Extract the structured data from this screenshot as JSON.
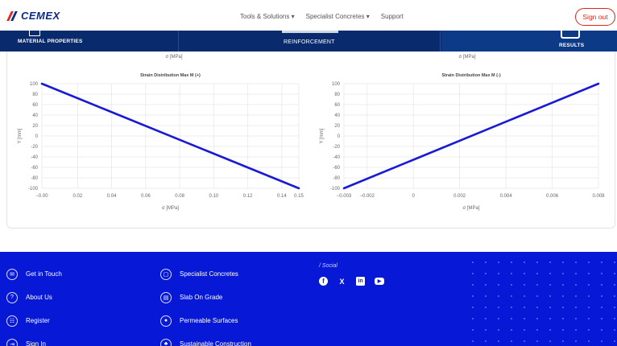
{
  "header": {
    "logo_text": "CEMEX",
    "nav": [
      "Tools & Solutions ▾",
      "Specialist Concretes ▾",
      "Support"
    ],
    "signout_label": "Sign out"
  },
  "tabs": {
    "material": "MATERIAL PROPERTIES",
    "reinforcement": "REINFORCEMENT",
    "results": "RESULTS"
  },
  "panel": {
    "top_left_label": "σ [MPa]",
    "top_right_label": "σ [MPa]"
  },
  "colors": {
    "brand_blue": "#0b2a8a",
    "brand_red": "#e2231a",
    "series_line": "#1a1ad6",
    "footer_bg": "#0718d6"
  },
  "chart_data": [
    {
      "type": "line",
      "title": "Strain Distribution Max M (+)",
      "xlabel": "σ [MPa]",
      "ylabel": "Y [mm]",
      "xlim": [
        -0.001,
        0.15
      ],
      "ylim": [
        -100,
        100
      ],
      "xticks": [
        -0.001,
        0.02,
        0.04,
        0.06,
        0.08,
        0.1,
        0.12,
        0.14,
        0.15
      ],
      "xtick_labels": [
        "−0.00",
        "0.02",
        "0.04",
        "0.06",
        "0.08",
        "0.10",
        "0.12",
        "0.14",
        "0.15"
      ],
      "yticks": [
        100,
        80,
        60,
        40,
        20,
        0,
        -20,
        -40,
        -60,
        -80,
        -100
      ],
      "grid": true,
      "series": [
        {
          "x": [
            -0.001,
            0.15
          ],
          "y": [
            100,
            -100
          ]
        }
      ]
    },
    {
      "type": "line",
      "title": "Strain Distribution Max M (-)",
      "xlabel": "σ [MPa]",
      "ylabel": "Y [mm]",
      "xlim": [
        -0.003,
        0.008
      ],
      "ylim": [
        -100,
        100
      ],
      "xticks": [
        -0.003,
        -0.002,
        0,
        0.002,
        0.004,
        0.006,
        0.008
      ],
      "xtick_labels": [
        "−0.003",
        "−0.002",
        "0",
        "0.002",
        "0.004",
        "0.006",
        "0.008"
      ],
      "yticks": [
        100,
        80,
        60,
        40,
        20,
        0,
        -20,
        -40,
        -60,
        -80,
        -100
      ],
      "grid": true,
      "series": [
        {
          "x": [
            -0.003,
            0.008
          ],
          "y": [
            -100,
            100
          ]
        }
      ]
    }
  ],
  "footer": {
    "col1": [
      {
        "label": "Get in Touch",
        "icon": "email-icon",
        "glyph": "✉"
      },
      {
        "label": "About Us",
        "icon": "help-icon",
        "glyph": "?"
      },
      {
        "label": "Register",
        "icon": "register-icon",
        "glyph": "☷"
      },
      {
        "label": "Sign In",
        "icon": "sign-in-icon",
        "glyph": "⇥"
      }
    ],
    "col2": [
      {
        "label": "Specialist Concretes",
        "icon": "concrete-icon",
        "glyph": "▢"
      },
      {
        "label": "Slab On Grade",
        "icon": "slab-icon",
        "glyph": "▤"
      },
      {
        "label": "Permeable Surfaces",
        "icon": "droplet-icon",
        "glyph": "●"
      },
      {
        "label": "Sustainable Construction",
        "icon": "leaf-icon",
        "glyph": "♣"
      }
    ],
    "social_title": "/ Social",
    "social": [
      {
        "icon": "facebook-icon",
        "glyph": "f"
      },
      {
        "icon": "x-twitter-icon",
        "glyph": "X"
      },
      {
        "icon": "linkedin-icon",
        "glyph": "in"
      },
      {
        "icon": "youtube-icon",
        "glyph": "▶"
      }
    ]
  }
}
